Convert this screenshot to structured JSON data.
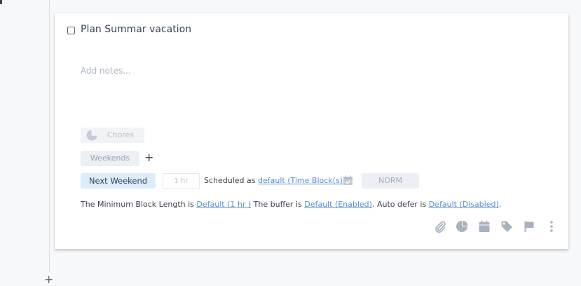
{
  "task": {
    "title": "Plan Summar vacation",
    "notes_placeholder": "Add notes...",
    "project": "Chores",
    "tag": "Weekends",
    "add_tag_symbol": "+",
    "when": "Next Weekend",
    "duration_placeholder": "1 hr",
    "scheduled_prefix": "Scheduled as ",
    "scheduled_link": "default (Time Block(s))",
    "priority": "NORM"
  },
  "settings_line": {
    "prefix": "The Minimum Block Length is ",
    "min_block_link": "Default (1 hr )",
    "buffer_prefix": " The buffer is ",
    "buffer_link": "Default (Enabled)",
    "autodefer_prefix": ". Auto defer is ",
    "autodefer_link": "Default (Disabled)",
    "suffix": "."
  },
  "toolbar_icons": [
    "paperclip-icon",
    "pie-chart-icon",
    "calendar-icon",
    "tag-icon",
    "flag-icon",
    "more-vertical-icon"
  ],
  "bottom_add_symbol": "+",
  "colors": {
    "link": "#5a8fd1",
    "icon": "#a8b2bf",
    "when_chip": "#dcecfb",
    "chip_gray": "#eceff3"
  }
}
